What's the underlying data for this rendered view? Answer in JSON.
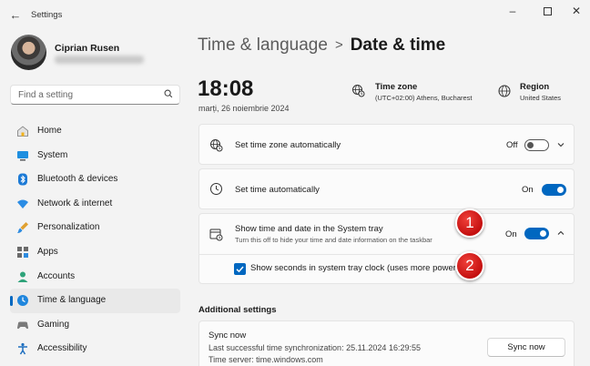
{
  "window": {
    "title": "Settings"
  },
  "user": {
    "name": "Ciprian Rusen"
  },
  "search": {
    "placeholder": "Find a setting"
  },
  "sidebar": {
    "items": [
      {
        "label": "Home",
        "icon": "home-icon"
      },
      {
        "label": "System",
        "icon": "system-icon"
      },
      {
        "label": "Bluetooth & devices",
        "icon": "bluetooth-icon"
      },
      {
        "label": "Network & internet",
        "icon": "wifi-icon"
      },
      {
        "label": "Personalization",
        "icon": "brush-icon"
      },
      {
        "label": "Apps",
        "icon": "apps-icon"
      },
      {
        "label": "Accounts",
        "icon": "accounts-icon"
      },
      {
        "label": "Time & language",
        "icon": "time-language-icon",
        "active": true
      },
      {
        "label": "Gaming",
        "icon": "gaming-icon"
      },
      {
        "label": "Accessibility",
        "icon": "accessibility-icon"
      }
    ]
  },
  "breadcrumb": {
    "parent": "Time & language",
    "separator": ">",
    "current": "Date & time"
  },
  "clock": {
    "time": "18:08",
    "date": "marți, 26 noiembrie 2024"
  },
  "timezone": {
    "title": "Time zone",
    "value": "(UTC+02:00) Athens, Bucharest"
  },
  "region": {
    "title": "Region",
    "value": "United States"
  },
  "settings": {
    "set_tz_auto": {
      "label": "Set time zone automatically",
      "state": "Off"
    },
    "set_time_auto": {
      "label": "Set time automatically",
      "state": "On"
    },
    "show_tray": {
      "label": "Show time and date in the System tray",
      "sub": "Turn this off to hide your time and date information on the taskbar",
      "state": "On"
    },
    "show_seconds": {
      "label": "Show seconds in system tray clock (uses more power)",
      "checked": true
    }
  },
  "markers": [
    "1",
    "2"
  ],
  "additional": {
    "title": "Additional settings",
    "sync_title": "Sync now",
    "last_sync": "Last successful time synchronization: 25.11.2024 16:29:55",
    "time_server": "Time server: time.windows.com",
    "sync_button": "Sync now"
  },
  "colors": {
    "accent": "#0067c0",
    "marker": "#d91f1f"
  }
}
